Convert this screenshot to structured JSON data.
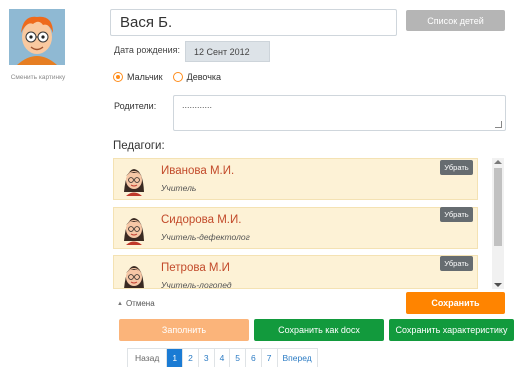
{
  "avatar": {
    "change_label": "Сменить картинку"
  },
  "child": {
    "name": "Вася Б.",
    "children_list_label": "Список детей",
    "dob_label": "Дата рождения:",
    "dob_value": "12 Сент 2012",
    "gender": {
      "boy": "Мальчик",
      "girl": "Девочка",
      "selected": "boy"
    },
    "parents_label": "Родители:",
    "parents_value": "............"
  },
  "teachers": {
    "title": "Педагоги:",
    "remove_label": "Убрать",
    "items": [
      {
        "name": "Иванова М.И.",
        "role": "Учитель"
      },
      {
        "name": "Сидорова М.И.",
        "role": "Учитель-дефектолог"
      },
      {
        "name": "Петрова М.И",
        "role": "Учитель-логопед"
      }
    ]
  },
  "actions": {
    "cancel": "Отмена",
    "save": "Сохранить",
    "fill": "Заполнить",
    "save_docx": "Сохранить как docx",
    "save_characteristic": "Сохранить характеристику"
  },
  "pager": {
    "prev": "Назад",
    "pages": [
      "1",
      "2",
      "3",
      "4",
      "5",
      "6",
      "7"
    ],
    "current": "1",
    "next": "Вперед"
  },
  "colors": {
    "accent_orange": "#ff8400",
    "green": "#129a3d",
    "light_orange": "#fbb47a",
    "teacher_name": "#c24a2a",
    "pager_active": "#1a7bd4"
  }
}
